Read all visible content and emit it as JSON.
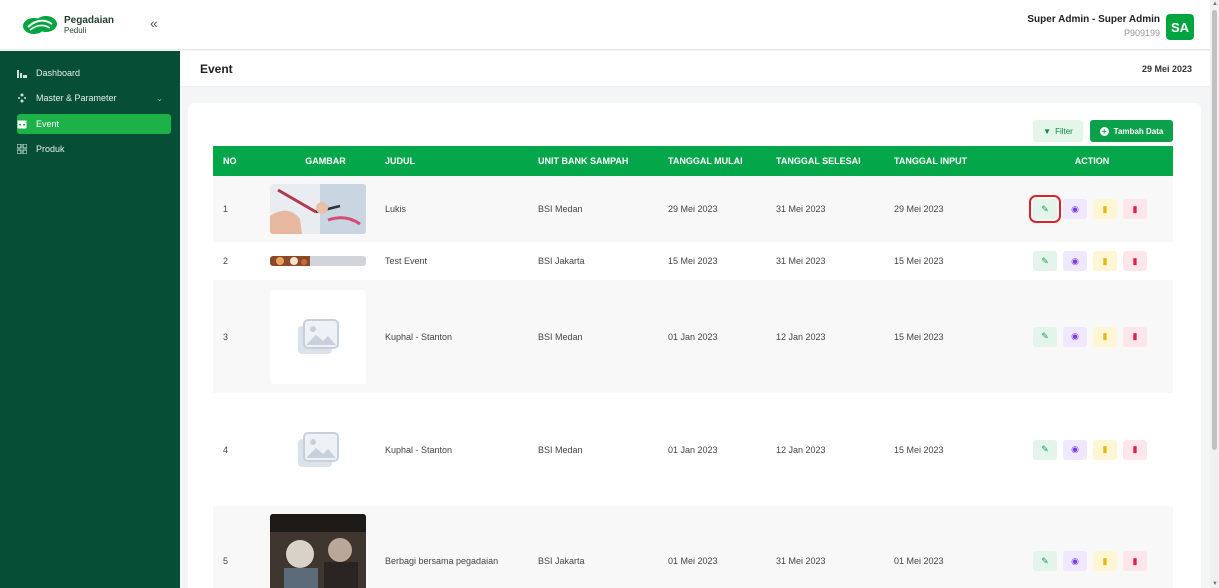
{
  "brand": {
    "name": "Pegadaian",
    "sub": "Peduli",
    "green": "#00a53f",
    "sidebar_bg": "#064f36"
  },
  "user": {
    "name": "Super Admin - Super Admin",
    "id": "P909199",
    "initials": "SA"
  },
  "sidebar": {
    "items": [
      {
        "label": "Dashboard",
        "icon": "chart-icon"
      },
      {
        "label": "Master & Parameter",
        "icon": "sliders-icon"
      },
      {
        "label": "Event",
        "icon": "calendar-icon",
        "active": true
      },
      {
        "label": "Produk",
        "icon": "grid-icon"
      }
    ]
  },
  "page": {
    "title": "Event",
    "date": "29 Mei 2023"
  },
  "toolbar": {
    "filter_label": "Filter",
    "add_label": "Tambah Data"
  },
  "table": {
    "headers": [
      "NO",
      "GAMBAR",
      "JUDUL",
      "UNIT BANK SAMPAH",
      "TANGGAL MULAI",
      "TANGGAL SELESAI",
      "TANGGAL INPUT",
      "ACTION"
    ],
    "rows": [
      {
        "no": "1",
        "image": "photo-painting",
        "judul": "Lukis",
        "unit": "BSI Medan",
        "mulai": "29 Mei 2023",
        "selesai": "31 Mei 2023",
        "input": "29 Mei 2023"
      },
      {
        "no": "2",
        "image": "photo-banner",
        "judul": "Test Event",
        "unit": "BSI Jakarta",
        "mulai": "15 Mei 2023",
        "selesai": "31 Mei 2023",
        "input": "15 Mei 2023"
      },
      {
        "no": "3",
        "image": "placeholder-image",
        "judul": "Kuphal - Stanton",
        "unit": "BSI Medan",
        "mulai": "01 Jan 2023",
        "selesai": "12 Jan 2023",
        "input": "15 Mei 2023"
      },
      {
        "no": "4",
        "image": "placeholder-image",
        "judul": "Kuphal - Stanton",
        "unit": "BSI Medan",
        "mulai": "01 Jan 2023",
        "selesai": "12 Jan 2023",
        "input": "15 Mei 2023"
      },
      {
        "no": "5",
        "image": "photo-volunteers",
        "judul": "Berbagi bersama pegadaian",
        "unit": "BSI Jakarta",
        "mulai": "01 Mei 2023",
        "selesai": "31 Mei 2023",
        "input": "01 Mei 2023"
      }
    ]
  }
}
